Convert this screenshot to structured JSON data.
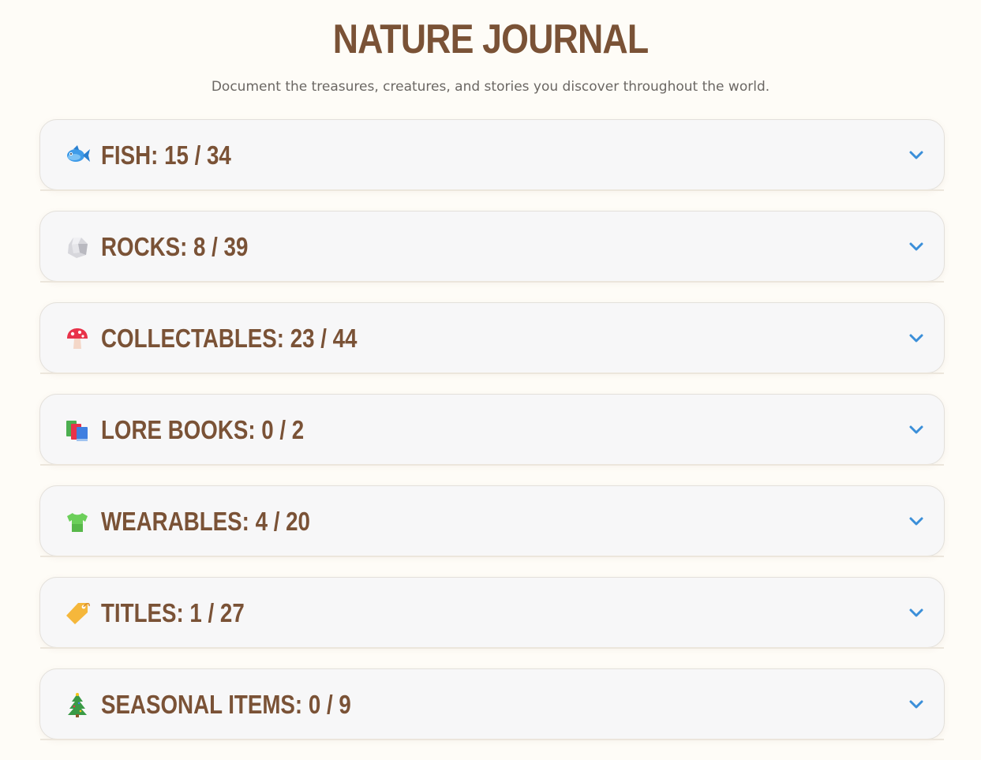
{
  "header": {
    "title": "NATURE JOURNAL",
    "subtitle": "Document the treasures, creatures, and stories you discover throughout the world."
  },
  "colors": {
    "title": "#7a5236",
    "accent_chevron": "#3b8fd9",
    "background": "#fefcf7",
    "card": "#f7f7f8"
  },
  "sections": [
    {
      "label": "FISH: 15 / 34",
      "icon": "fish-icon"
    },
    {
      "label": "ROCKS: 8 / 39",
      "icon": "rock-icon"
    },
    {
      "label": "COLLECTABLES: 23 / 44",
      "icon": "mushroom-icon"
    },
    {
      "label": "LORE BOOKS: 0 / 2",
      "icon": "books-icon"
    },
    {
      "label": "WEARABLES: 4 / 20",
      "icon": "tshirt-icon"
    },
    {
      "label": "TITLES: 1 / 27",
      "icon": "tag-icon"
    },
    {
      "label": "SEASONAL ITEMS: 0 / 9",
      "icon": "tree-icon"
    }
  ]
}
